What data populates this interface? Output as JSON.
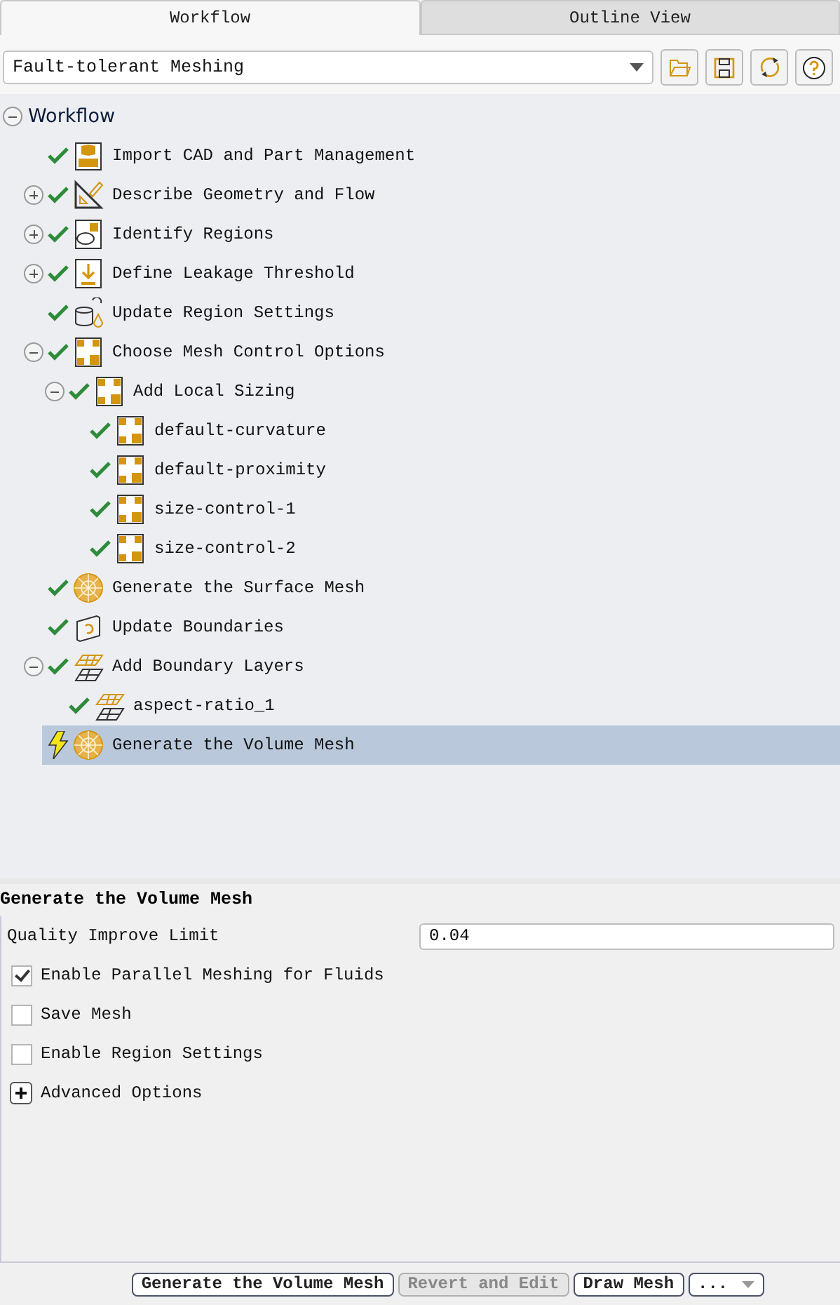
{
  "tabs": [
    {
      "label": "Workflow",
      "selected": true
    },
    {
      "label": "Outline View",
      "selected": false
    }
  ],
  "workflow_select": {
    "value": "Fault-tolerant Meshing"
  },
  "toolbar_buttons": [
    {
      "kind": "open"
    },
    {
      "kind": "save"
    },
    {
      "kind": "refresh"
    },
    {
      "kind": "help"
    }
  ],
  "tree": {
    "label": "Workflow",
    "expanded": true,
    "children": [
      {
        "label": "Import CAD and Part Management",
        "warning": false,
        "kind": "cad",
        "selected": false
      },
      {
        "label": "Describe Geometry and Flow",
        "warning": false,
        "kind": "geometry",
        "expanded": false,
        "selected": false
      },
      {
        "label": "Identify Regions",
        "warning": false,
        "kind": "regions",
        "expanded": false,
        "selected": false
      },
      {
        "label": "Define Leakage Threshold",
        "warning": false,
        "kind": "leakage",
        "expanded": false,
        "selected": false
      },
      {
        "label": "Update Region Settings",
        "warning": false,
        "kind": "settings",
        "selected": false
      },
      {
        "label": "Choose Mesh Control Options",
        "warning": false,
        "kind": "control",
        "expanded": true,
        "selected": false,
        "children": [
          {
            "label": "Add Local Sizing",
            "warning": false,
            "kind": "control",
            "expanded": true,
            "selected": false,
            "children": [
              {
                "label": "default-curvature",
                "warning": false,
                "kind": "control",
                "selected": false
              },
              {
                "label": "default-proximity",
                "warning": false,
                "kind": "control",
                "selected": false
              },
              {
                "label": "size-control-1",
                "warning": false,
                "kind": "control",
                "selected": false
              },
              {
                "label": "size-control-2",
                "warning": false,
                "kind": "control",
                "selected": false
              }
            ]
          }
        ]
      },
      {
        "label": "Generate the Surface Mesh",
        "warning": false,
        "kind": "sphere",
        "selected": false
      },
      {
        "label": "Update Boundaries",
        "warning": false,
        "kind": "boundaries",
        "selected": false
      },
      {
        "label": "Add Boundary Layers",
        "warning": false,
        "kind": "layers",
        "expanded": true,
        "selected": false,
        "children": [
          {
            "label": "aspect-ratio_1",
            "warning": false,
            "kind": "layers",
            "selected": false
          }
        ]
      },
      {
        "label": "Generate the Volume Mesh",
        "warning": true,
        "kind": "sphere",
        "selected": true
      }
    ]
  },
  "properties": {
    "title": "Generate the Volume Mesh",
    "fields": [
      {
        "kind": "input",
        "label": "Quality Improve Limit",
        "value": "0.04"
      },
      {
        "kind": "checkbox",
        "label": "Enable Parallel Meshing for Fluids",
        "checked": true
      },
      {
        "kind": "checkbox",
        "label": "Save Mesh",
        "checked": false
      },
      {
        "kind": "checkbox",
        "label": "Enable Region Settings",
        "checked": false
      },
      {
        "kind": "expander",
        "label": "Advanced Options",
        "expanded": false
      }
    ]
  },
  "buttons": [
    {
      "kind": "button",
      "label": "Generate the Volume Mesh",
      "disabled": false
    },
    {
      "kind": "button",
      "label": "Revert and Edit",
      "disabled": true
    },
    {
      "kind": "button",
      "label": "Draw Mesh",
      "disabled": false
    },
    {
      "kind": "dropdown",
      "label": "...",
      "disabled": false
    }
  ]
}
